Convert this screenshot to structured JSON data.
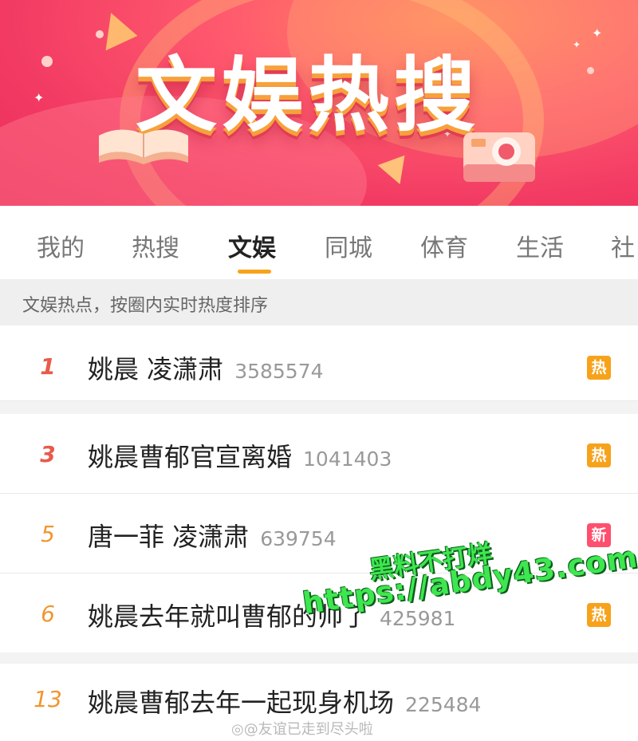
{
  "banner": {
    "title": "文娱热搜"
  },
  "tabs": [
    {
      "label": "我的"
    },
    {
      "label": "热搜"
    },
    {
      "label": "文娱"
    },
    {
      "label": "同城"
    },
    {
      "label": "体育"
    },
    {
      "label": "生活"
    },
    {
      "label": "社"
    }
  ],
  "active_tab": "文娱",
  "info": "文娱热点，按圈内实时热度排序",
  "list": [
    {
      "rank": "1",
      "title": "姚晨 凌潇肃",
      "count": "3585574",
      "badge": "热"
    },
    {
      "rank": "3",
      "title": "姚晨曹郁官宣离婚",
      "count": "1041403",
      "badge": "热"
    },
    {
      "rank": "5",
      "title": "唐一菲 凌潇肃",
      "count": "639754",
      "badge": "新"
    },
    {
      "rank": "6",
      "title": "姚晨去年就叫曹郁的帅了",
      "count": "425981",
      "badge": "热"
    },
    {
      "rank": "13",
      "title": "姚晨曹郁去年一起现身机场",
      "count": "225484",
      "badge": ""
    }
  ],
  "watermarks": {
    "line1": "黑料不打烊",
    "line2": "https://abdy43.com",
    "weibo": "@友谊已走到尽头啦"
  },
  "colors": {
    "banner_main": "#f23a63",
    "tab_underline": "#f7a31a",
    "rank_red": "#e95a4a",
    "rank_orange": "#f0962d",
    "badge_hot": "#f7a21b",
    "badge_new": "#ff4f6e",
    "watermark_green": "#3ee64f"
  },
  "icons": [
    "book-icon",
    "camera-icon",
    "sparkle-icon",
    "weibo-icon"
  ]
}
